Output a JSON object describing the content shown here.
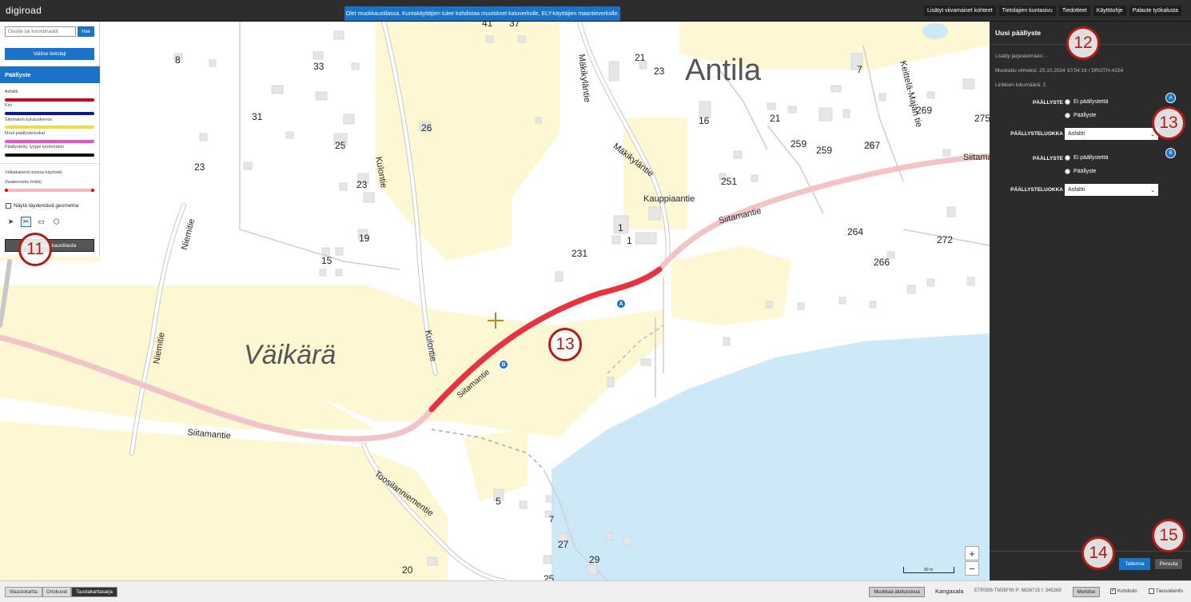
{
  "app": {
    "logo": "digiroad"
  },
  "banner": "Olet muokkaustilassa. Kuntakäyttäjien tulee kohdistaa muutokset katuverkolle, ELY-käyttäjien maantieverkolle.",
  "topnav": [
    {
      "label": "Lisätyt viivamaiset kohteet"
    },
    {
      "label": "Tietolajien kuntasivu"
    },
    {
      "label": "Tiedotteet"
    },
    {
      "label": "Käyttöohje"
    },
    {
      "label": "Palaute työkalusta"
    }
  ],
  "left_panel": {
    "search_placeholder": "Osoite tai koordinaatit",
    "search_button": "Hae",
    "select_layer_button": "Valitse tietolaji",
    "layer_title": "Päällyste",
    "legend": [
      {
        "label": "Asfaltti",
        "color": "#e0001a"
      },
      {
        "label": "Kivi",
        "color": "#0c1e8c"
      },
      {
        "label": "Sitomaton kulutuskerros",
        "color": "#f3dc3b"
      },
      {
        "label": "Muut päällysteluokat",
        "color": "#f04ecb"
      },
      {
        "label": "Päällystetty, tyyppi tuntematon",
        "color": "#111111"
      }
    ],
    "inactive_label_1": "Väliaikaisesti poissa käytöstä",
    "inactive_label_2": "(haalennettu linkki)",
    "inactive_color": "#f5b7c0",
    "geometry_checkbox": "Näytä täydentävä geometria",
    "exit_button": "Poistu muokkaustilasta"
  },
  "right_panel": {
    "title": "Uusi päällyste",
    "added_in_system": "Lisätty järjestelmään: -",
    "last_modified": "Muokattu viimeksi: 25.10.2024 10:54:16 / DROTH-4154",
    "link_count": "Linkkien lukumäärä: 2",
    "sections": [
      {
        "badge": "A",
        "field_label": "PÄÄLLYSTE",
        "options": [
          "Ei päällystettä",
          "Päällyste"
        ],
        "selected": "Päällyste",
        "class_label": "PÄÄLLYSTELUOKKA",
        "class_value": "Asfaltti"
      },
      {
        "badge": "B",
        "field_label": "PÄÄLLYSTE",
        "options": [
          "Ei päällystettä",
          "Päällyste"
        ],
        "selected": "Päällyste",
        "class_label": "PÄÄLLYSTELUOKKA",
        "class_value": "Asfaltti"
      }
    ],
    "save_button": "Tallenna",
    "cancel_button": "Peruuta"
  },
  "map": {
    "place_names": [
      "Antila",
      "Väikärä"
    ],
    "road_names": [
      "Siitamantie",
      "Siitamantie",
      "Siitamantie",
      "Siitamantie",
      "Kulontie",
      "Kulontie",
      "Niemitie",
      "Niemitie",
      "Mäkikyläntie",
      "Mäkikyläntie",
      "Kauppiaantie",
      "Keittelä-Majan tie",
      "Toosilanniementie"
    ],
    "house_numbers": [
      "41",
      "37",
      "8",
      "33",
      "21",
      "23",
      "7",
      "31",
      "26",
      "16",
      "21",
      "269",
      "275",
      "25",
      "259",
      "259",
      "267",
      "23",
      "23",
      "251",
      "1",
      "1",
      "19",
      "15",
      "231",
      "264",
      "272",
      "266",
      "5",
      "7",
      "27",
      "29",
      "20",
      "25"
    ],
    "markers": [
      "A",
      "B"
    ],
    "scale_label": "50 m",
    "zoom_in": "+",
    "zoom_out": "−"
  },
  "callouts": [
    "11",
    "12",
    "13",
    "13",
    "14",
    "15"
  ],
  "bottom_bar": {
    "base_tabs": [
      "Maastokartta",
      "Ortokuvat",
      "Taustakarttasarja"
    ],
    "active_tab": "Taustakarttasarja",
    "edit_start_button": "Muokkaa aloitussivua",
    "municipality": "Kangasala",
    "coordinates": "ETRS89-TM35FIN  P: 6826715  I: 345269",
    "mark_button": "Merkitse",
    "crosshair_checkbox": "Kohdistin",
    "road_info_checkbox": "Tieosoiteinfo"
  }
}
